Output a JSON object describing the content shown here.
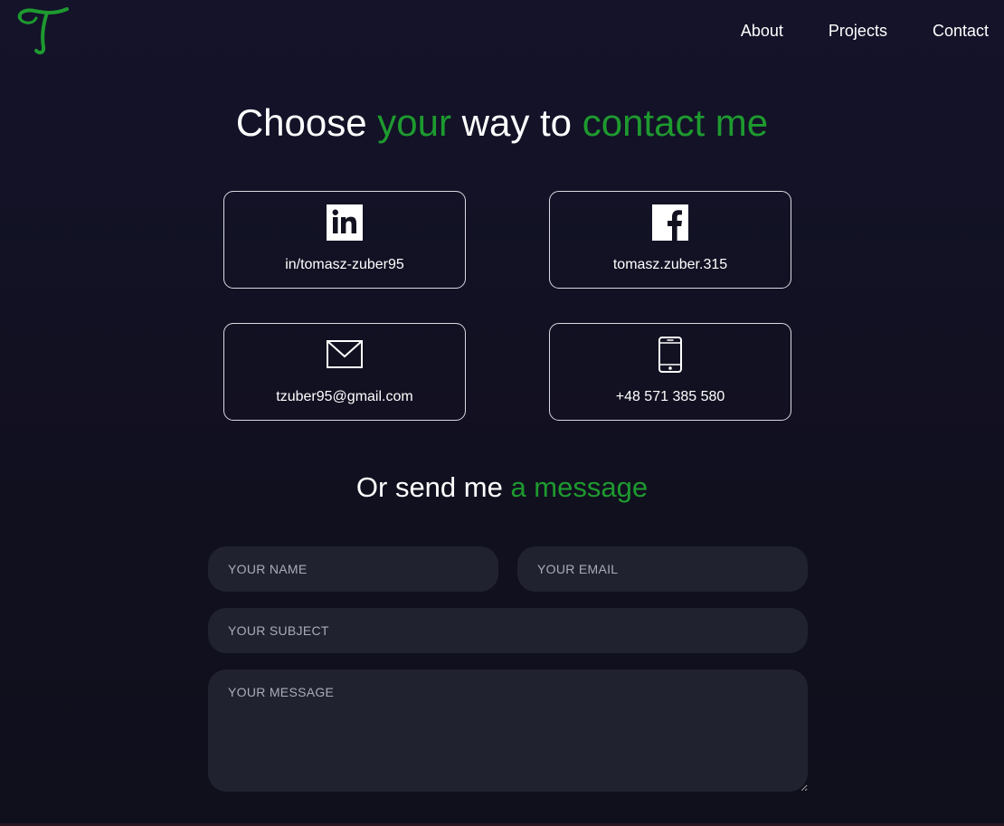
{
  "header": {
    "logo_letter": "T",
    "nav": {
      "about": "About",
      "projects": "Projects",
      "contact": "Contact"
    }
  },
  "heading": {
    "part1": "Choose ",
    "part2": "your",
    "part3": " way to ",
    "part4": "contact me"
  },
  "contacts": {
    "linkedin": {
      "icon": "linkedin-icon",
      "label": "in/tomasz-zuber95"
    },
    "facebook": {
      "icon": "facebook-icon",
      "label": "tomasz.zuber.315"
    },
    "email": {
      "icon": "envelope-icon",
      "label": "tzuber95@gmail.com"
    },
    "phone": {
      "icon": "smartphone-icon",
      "label": "+48 571 385 580"
    }
  },
  "subheading": {
    "part1": "Or send me ",
    "part2": "a message"
  },
  "form": {
    "name_placeholder": "YOUR NAME",
    "email_placeholder": "YOUR EMAIL",
    "subject_placeholder": "YOUR SUBJECT",
    "message_placeholder": "YOUR MESSAGE"
  },
  "colors": {
    "background": "#12111f",
    "accent": "#1e9a2f",
    "field_background": "#20232f",
    "card_border": "#d9d9e2"
  }
}
